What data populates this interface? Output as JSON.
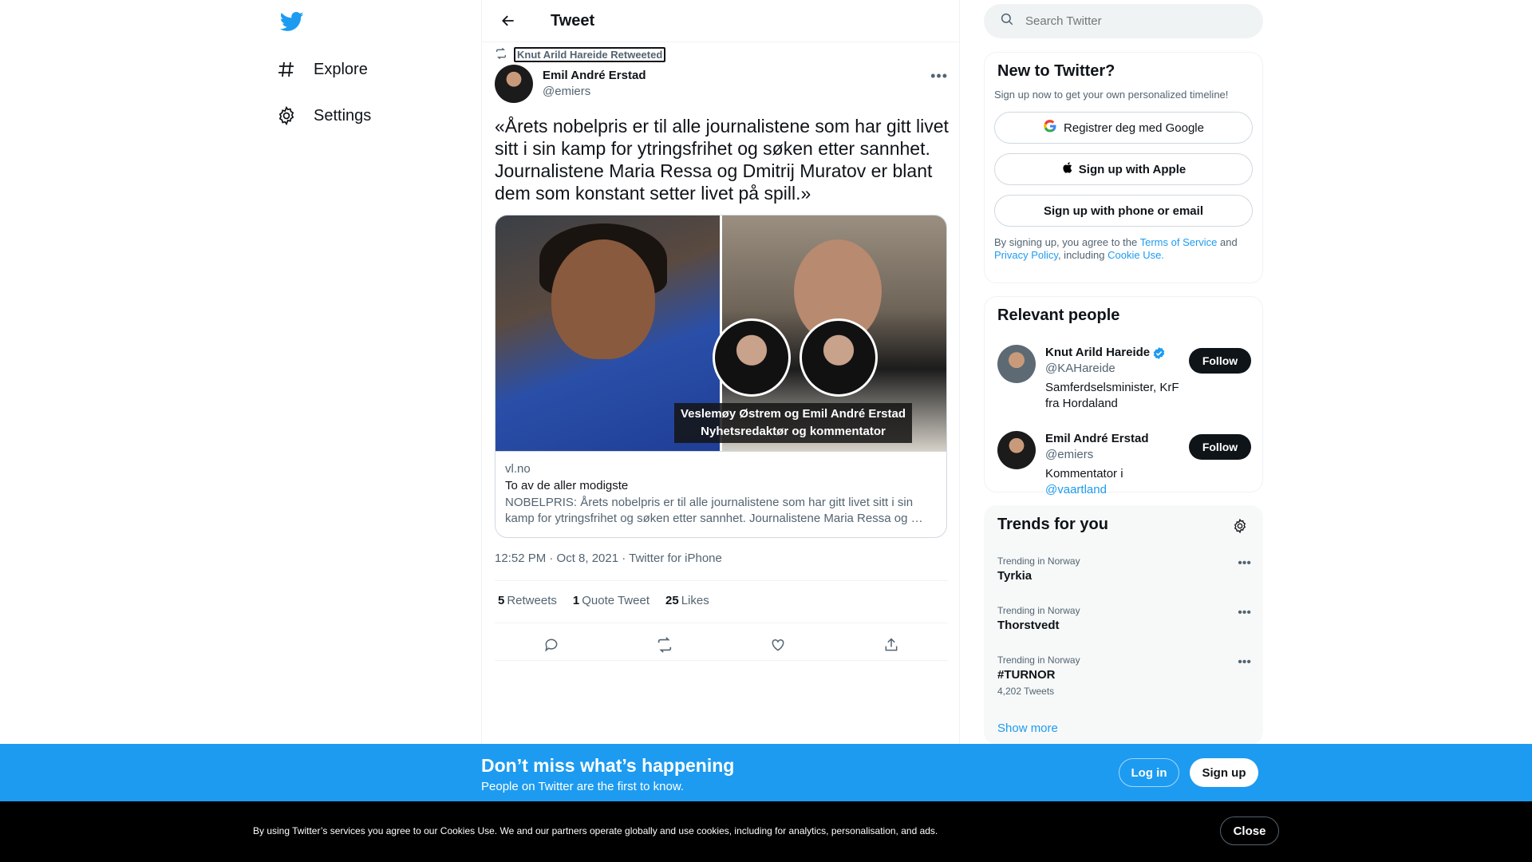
{
  "nav": {
    "items": [
      {
        "label": "Explore",
        "icon": "hashtag-icon"
      },
      {
        "label": "Settings",
        "icon": "gear-icon"
      }
    ]
  },
  "header": {
    "title": "Tweet"
  },
  "tweet": {
    "retweeted_by": "Knut Arild Hareide Retweeted",
    "author_name": "Emil André Erstad",
    "author_handle": "@emiers",
    "text": "«Årets nobelpris er til alle journalistene som har gitt livet sitt i sin kamp for ytringsfrihet og søken etter sannhet. Journalistene Maria Ressa og Dmitrij Muratov er blant dem som konstant setter livet på spill.»",
    "card": {
      "image_caption_line1": "Veslemøy Østrem og Emil André Erstad",
      "image_caption_line2": "Nyhetsredaktør og kommentator",
      "domain": "vl.no",
      "title": "To av de aller modigste",
      "description": "NOBELPRIS: Årets nobelpris er til alle journalistene som har gitt livet sitt i sin kamp for ytringsfrihet og søken etter sannhet. Journalistene Maria Ressa og …"
    },
    "meta": "12:52 PM · Oct 8, 2021 · Twitter for iPhone",
    "stats": {
      "retweets_count": "5",
      "retweets_label": "Retweets",
      "quotes_count": "1",
      "quotes_label": "Quote Tweet",
      "likes_count": "25",
      "likes_label": "Likes"
    }
  },
  "search": {
    "placeholder": "Search Twitter"
  },
  "signup_panel": {
    "title": "New to Twitter?",
    "subtitle": "Sign up now to get your own personalized timeline!",
    "google_label": "Registrer deg med Google",
    "apple_label": "Sign up with Apple",
    "phone_label": "Sign up with phone or email",
    "terms_prefix": "By signing up, you agree to the ",
    "terms_link": "Terms of Service",
    "terms_and": " and",
    "privacy_link": "Privacy Policy",
    "terms_including": ", including ",
    "cookie_link": "Cookie Use."
  },
  "relevant_people": {
    "title": "Relevant people",
    "people": [
      {
        "name": "Knut Arild Hareide",
        "handle": "@KAHareide",
        "bio": "Samferdselsminister, KrF fra Hordaland",
        "follow": "Follow",
        "verified": true
      },
      {
        "name": "Emil André Erstad",
        "handle": "@emiers",
        "bio_prefix": "Kommentator i ",
        "bio_link": "@vaartland",
        "follow": "Follow"
      }
    ]
  },
  "trends": {
    "title": "Trends for you",
    "items": [
      {
        "context": "Trending in Norway",
        "name": "Tyrkia"
      },
      {
        "context": "Trending in Norway",
        "name": "Thorstvedt"
      },
      {
        "context": "Trending in Norway",
        "name": "#TURNOR",
        "count": "4,202 Tweets"
      }
    ],
    "show_more": "Show more"
  },
  "banner": {
    "title": "Don’t miss what’s happening",
    "subtitle": "People on Twitter are the first to know.",
    "login": "Log in",
    "signup": "Sign up"
  },
  "cookie_bar": {
    "text": "By using Twitter’s services you agree to our Cookies Use. We and our partners operate globally and use cookies, including for analytics, personalisation, and ads.",
    "close": "Close"
  },
  "colors": {
    "accent": "#1d9bf0",
    "text": "#0f1419",
    "secondary": "#536471"
  }
}
